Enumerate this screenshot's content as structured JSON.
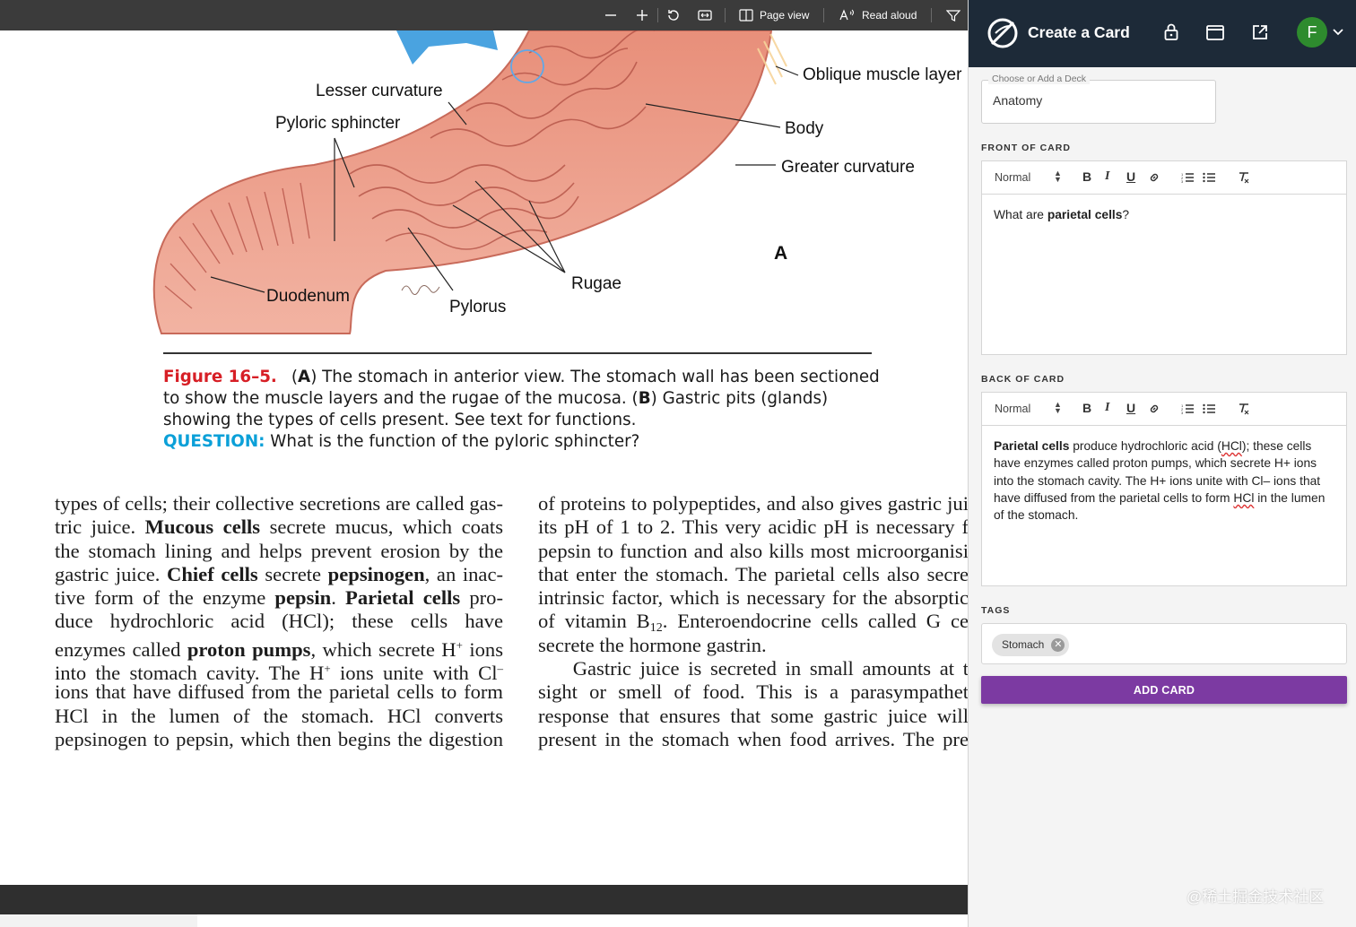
{
  "pdf_toolbar": {
    "page_view_label": "Page view",
    "read_aloud_label": "Read aloud"
  },
  "figure": {
    "labels": {
      "lesser_curvature": "Lesser curvature",
      "pyloric_sphincter": "Pyloric sphincter",
      "oblique_muscle_layer": "Oblique muscle layer",
      "body": "Body",
      "greater_curvature": "Greater curvature",
      "panel_a": "A",
      "rugae": "Rugae",
      "duodenum": "Duodenum",
      "pylorus": "Pylorus"
    },
    "caption": {
      "number": "Figure 16–5.",
      "part_a_marker": "A",
      "text_1": ") The stomach in anterior view. The stomach wall has been sectioned to show the muscle layers and the rugae of the mucosa. (",
      "part_b_marker": "B",
      "text_2": ") Gastric pits (glands) showing the types of cells present. See text for functions.",
      "question_label": "QUESTION:",
      "question_text": " What is the function of the pyloric sphincter?"
    }
  },
  "body_text": {
    "left": {
      "l1": "types of cells; their collective secretions are called gas-",
      "l2a": "tric juice. ",
      "l2b": "Mucous cells",
      "l2c": " secrete mucus, which coats",
      "l3": "the stomach lining and helps prevent erosion by the",
      "l4a": "gastric juice. ",
      "l4b": "Chief cells",
      "l4c": " secrete ",
      "l4d": "pepsinogen",
      "l4e": ", an inac-",
      "l5a": "tive form of the enzyme ",
      "l5b": "pepsin",
      "l5c": ". ",
      "l5d": "Parietal cells",
      "l5e": " pro-",
      "l6": "duce hydrochloric acid (HCl); these cells have",
      "l7a": "enzymes called ",
      "l7b": "proton pumps",
      "l7c": ", which secrete H",
      "l7d": "+",
      "l7e": " ions",
      "l8a": "into the stomach cavity. The H",
      "l8b": "+",
      "l8c": " ions unite with Cl",
      "l8d": "–",
      "l9": "ions that have diffused from the parietal cells to form",
      "l10": "HCl in the lumen of the stomach. HCl converts",
      "l11": "pepsinogen to pepsin, which then begins the digestion"
    },
    "right": {
      "l1": "of proteins to polypeptides, and also gives gastric jui",
      "l2": "its pH of 1 to 2. This very acidic pH is necessary f",
      "l3": "pepsin to function and also kills most microorganisi",
      "l4": "that enter the stomach. The parietal cells also secre",
      "l5": "intrinsic factor, which is necessary for the absorptic",
      "l6a": "of vitamin B",
      "l6b": "12",
      "l6c": ". Enteroendocrine cells called G ce",
      "l7": "secrete the hormone gastrin.",
      "l8": "    Gastric juice is secreted in small amounts at t",
      "l9": "sight or smell of food. This is a parasympathet",
      "l10": "response that ensures that some gastric juice will",
      "l11": "present in the stomach when food arrives. The pre"
    }
  },
  "panel": {
    "title": "Create a Card",
    "avatar_letter": "F",
    "deck": {
      "label": "Choose or Add a Deck",
      "value": "Anatomy"
    },
    "front": {
      "heading": "FRONT OF CARD",
      "format": "Normal",
      "t1": "What are ",
      "t2": "parietal cells",
      "t3": "?"
    },
    "back": {
      "heading": "BACK OF CARD",
      "format": "Normal",
      "b1": "Parietal cells",
      "b2": " produce hydrochloric acid (",
      "b3": "HCl",
      "b4": "); these cells have enzymes called proton pumps, which secrete H+ ions into the stomach cavity. The H+ ions unite with Cl– ions that have diffused from the parietal cells to form ",
      "b5": "HCl",
      "b6": " in the lumen of the stomach."
    },
    "tags": {
      "heading": "TAGS",
      "items": [
        "Stomach"
      ]
    },
    "add_button": "ADD CARD",
    "toolbar_buttons": {
      "bold": "B",
      "italic": "I",
      "underline": "U"
    }
  },
  "watermark": "@稀土掘金技术社区",
  "icons": [
    "zoom-out-icon",
    "zoom-in-icon",
    "rotate-icon",
    "fit-page-icon",
    "page-view-icon",
    "read-aloud-icon",
    "filter-icon",
    "logo-icon",
    "lock-icon",
    "window-icon",
    "open-external-icon",
    "chevron-down-icon",
    "link-icon",
    "ordered-list-icon",
    "bullet-list-icon",
    "clear-format-icon",
    "remove-tag-icon"
  ],
  "colors": {
    "panel_header": "#1d2a38",
    "add_button": "#7c3aa2",
    "figure_number": "#d71f26",
    "question": "#0ba0d8",
    "avatar": "#2e8b2e"
  }
}
